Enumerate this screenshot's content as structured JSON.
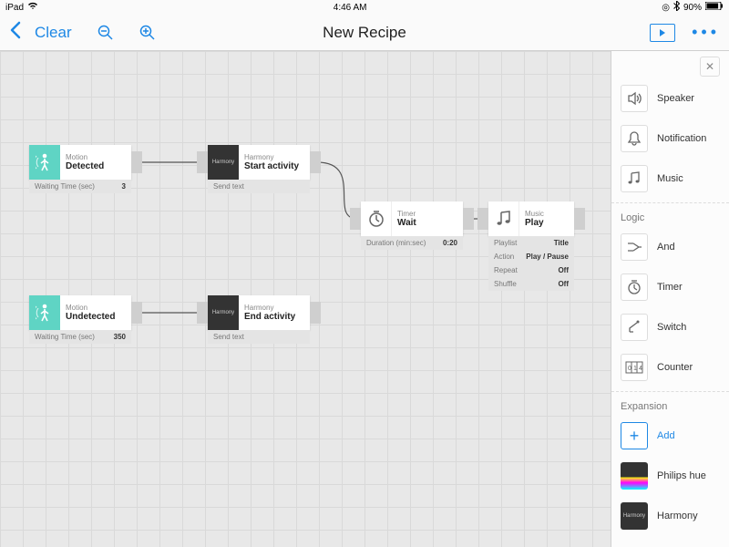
{
  "status": {
    "device": "iPad",
    "time": "4:46 AM",
    "battery": "90%"
  },
  "toolbar": {
    "clear": "Clear",
    "title": "New Recipe"
  },
  "nodes": {
    "motion_detected": {
      "category": "Motion",
      "label": "Detected",
      "params": [
        {
          "k": "Waiting Time (sec)",
          "v": "3"
        }
      ]
    },
    "harmony_start": {
      "category": "Harmony",
      "label": "Start activity",
      "icon_text": "Harmony",
      "params": [
        {
          "k": "Send text",
          "v": ""
        }
      ]
    },
    "timer_wait": {
      "category": "Timer",
      "label": "Wait",
      "params": [
        {
          "k": "Duration (min:sec)",
          "v": "0:20"
        }
      ]
    },
    "music_play": {
      "category": "Music",
      "label": "Play",
      "params": [
        {
          "k": "Playlist",
          "v": "Title"
        },
        {
          "k": "Action",
          "v": "Play / Pause"
        },
        {
          "k": "Repeat",
          "v": "Off"
        },
        {
          "k": "Shuffle",
          "v": "Off"
        }
      ]
    },
    "motion_undetected": {
      "category": "Motion",
      "label": "Undetected",
      "params": [
        {
          "k": "Waiting Time (sec)",
          "v": "350"
        }
      ]
    },
    "harmony_end": {
      "category": "Harmony",
      "label": "End activity",
      "icon_text": "Harmony",
      "params": [
        {
          "k": "Send text",
          "v": ""
        }
      ]
    }
  },
  "sidebar": {
    "actions": [
      {
        "id": "speaker",
        "label": "Speaker"
      },
      {
        "id": "notification",
        "label": "Notification"
      },
      {
        "id": "music",
        "label": "Music"
      }
    ],
    "logic_header": "Logic",
    "logic": [
      {
        "id": "and",
        "label": "And"
      },
      {
        "id": "timer",
        "label": "Timer"
      },
      {
        "id": "switch",
        "label": "Switch"
      },
      {
        "id": "counter",
        "label": "Counter"
      }
    ],
    "expansion_header": "Expansion",
    "expansion_add": "Add",
    "expansion": [
      {
        "id": "hue",
        "label": "Philips hue"
      },
      {
        "id": "harmony",
        "label": "Harmony"
      }
    ]
  }
}
